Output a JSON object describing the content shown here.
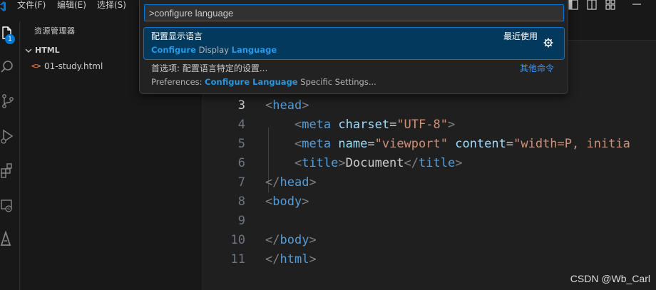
{
  "menu": {
    "file": "文件(F)",
    "edit": "编辑(E)",
    "selection": "选择(S)"
  },
  "activity_bar": {
    "icons": [
      "files-icon",
      "search-icon",
      "source-control-icon",
      "run-debug-icon",
      "extensions-icon",
      "remote-explorer-icon",
      "testing-icon"
    ],
    "badge": "1"
  },
  "sidebar": {
    "title": "资源管理器",
    "section": "HTML",
    "files": [
      {
        "icon": "<>",
        "name": "01-study.html"
      }
    ]
  },
  "command_palette": {
    "input_value": ">configure language",
    "items": [
      {
        "label": "配置显示语言",
        "detail_parts": [
          {
            "text": "Configure",
            "highlight": true
          },
          {
            "text": " Display ",
            "highlight": false
          },
          {
            "text": "Language",
            "highlight": true
          }
        ],
        "tag": "最近使用",
        "selected": true
      },
      {
        "label": "首选项: 配置语言特定的设置...",
        "detail_parts": [
          {
            "text": "Preferences: ",
            "highlight": false
          },
          {
            "text": "Configure Language",
            "highlight": true
          },
          {
            "text": " Specific Settings...",
            "highlight": false
          }
        ],
        "tag": "其他命令",
        "selected": false
      }
    ]
  },
  "editor": {
    "active_line": 3,
    "lines": [
      {
        "num": "3",
        "tokens": [
          [
            "br",
            "<"
          ],
          [
            "tag",
            "head"
          ],
          [
            "br",
            ">"
          ]
        ]
      },
      {
        "num": "4",
        "tokens": [
          [
            "txt",
            "    "
          ],
          [
            "br",
            "<"
          ],
          [
            "tag",
            "meta"
          ],
          [
            "txt",
            " "
          ],
          [
            "attr",
            "charset"
          ],
          [
            "txt",
            "="
          ],
          [
            "str",
            "\"UTF-8\""
          ],
          [
            "br",
            ">"
          ]
        ]
      },
      {
        "num": "5",
        "tokens": [
          [
            "txt",
            "    "
          ],
          [
            "br",
            "<"
          ],
          [
            "tag",
            "meta"
          ],
          [
            "txt",
            " "
          ],
          [
            "attr",
            "name"
          ],
          [
            "txt",
            "="
          ],
          [
            "str",
            "\"viewport\""
          ],
          [
            "txt",
            " "
          ],
          [
            "attr",
            "content"
          ],
          [
            "txt",
            "="
          ],
          [
            "str",
            "\"width=P, initia"
          ]
        ]
      },
      {
        "num": "6",
        "tokens": [
          [
            "txt",
            "    "
          ],
          [
            "br",
            "<"
          ],
          [
            "tag",
            "title"
          ],
          [
            "br",
            ">"
          ],
          [
            "txt",
            "Document"
          ],
          [
            "br",
            "</"
          ],
          [
            "tag",
            "title"
          ],
          [
            "br",
            ">"
          ]
        ]
      },
      {
        "num": "7",
        "tokens": [
          [
            "br",
            "</"
          ],
          [
            "tag",
            "head"
          ],
          [
            "br",
            ">"
          ]
        ]
      },
      {
        "num": "8",
        "tokens": [
          [
            "br",
            "<"
          ],
          [
            "tag",
            "body"
          ],
          [
            "br",
            ">"
          ]
        ]
      },
      {
        "num": "9",
        "tokens": []
      },
      {
        "num": "10",
        "tokens": [
          [
            "br",
            "</"
          ],
          [
            "tag",
            "body"
          ],
          [
            "br",
            ">"
          ]
        ]
      },
      {
        "num": "11",
        "tokens": [
          [
            "br",
            "</"
          ],
          [
            "tag",
            "html"
          ],
          [
            "br",
            ">"
          ]
        ]
      }
    ]
  },
  "watermark": "CSDN @Wb_Carl",
  "colors": {
    "accent": "#0078d4",
    "selection_bg": "#04395e",
    "match_highlight": "#2aaaff",
    "link": "#3794ff",
    "tag": "#569cd6",
    "attr": "#9cdcfe",
    "string": "#ce9178"
  }
}
